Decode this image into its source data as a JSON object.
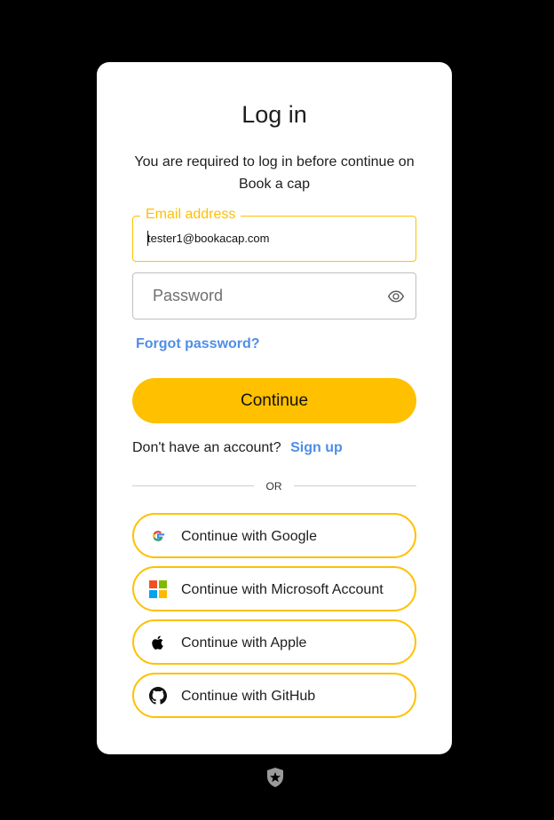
{
  "login": {
    "title": "Log in",
    "subtitle": "You are required to log in before continue on Book a cap",
    "email_label": "Email address",
    "email_value": "tester1@bookacap.com",
    "password_placeholder": "Password",
    "forgot_password": "Forgot password?",
    "continue": "Continue",
    "no_account_text": "Don't have an account?",
    "sign_up": "Sign up",
    "divider": "OR"
  },
  "social": [
    {
      "label": "Continue with Google",
      "icon": "google-icon"
    },
    {
      "label": "Continue with Microsoft Account",
      "icon": "microsoft-icon"
    },
    {
      "label": "Continue with Apple",
      "icon": "apple-icon"
    },
    {
      "label": "Continue with GitHub",
      "icon": "github-icon"
    }
  ],
  "colors": {
    "accent": "#ffc000",
    "link": "#4f8ee8",
    "background": "#000000",
    "card": "#ffffff"
  },
  "footer": {
    "icon": "auth0-shield-icon"
  }
}
